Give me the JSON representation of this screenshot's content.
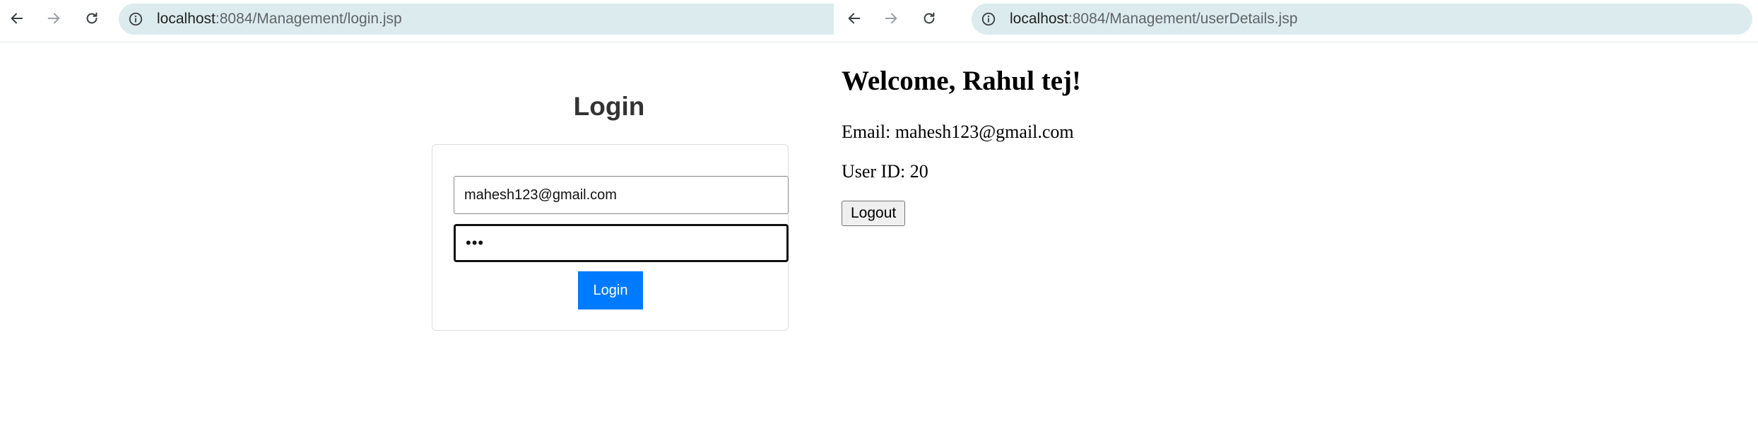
{
  "left_window": {
    "url_host": "localhost",
    "url_rest": ":8084/Management/login.jsp",
    "page": {
      "title": "Login",
      "email_value": "mahesh123@gmail.com",
      "password_masked": "•••",
      "button_label": "Login"
    }
  },
  "right_window": {
    "url_host": "localhost",
    "url_rest": ":8084/Management/userDetails.jsp",
    "page": {
      "welcome": "Welcome, Rahul tej!",
      "email_line": "Email: mahesh123@gmail.com",
      "user_id_line": "User ID: 20",
      "logout_label": "Logout"
    }
  },
  "colors": {
    "omnibox_bg": "#dcebed",
    "login_button": "#007bff",
    "title_text": "#333333"
  },
  "icons": {
    "back": "arrow-left",
    "forward": "arrow-right",
    "reload": "circular-arrow",
    "site_info": "info-circle"
  }
}
